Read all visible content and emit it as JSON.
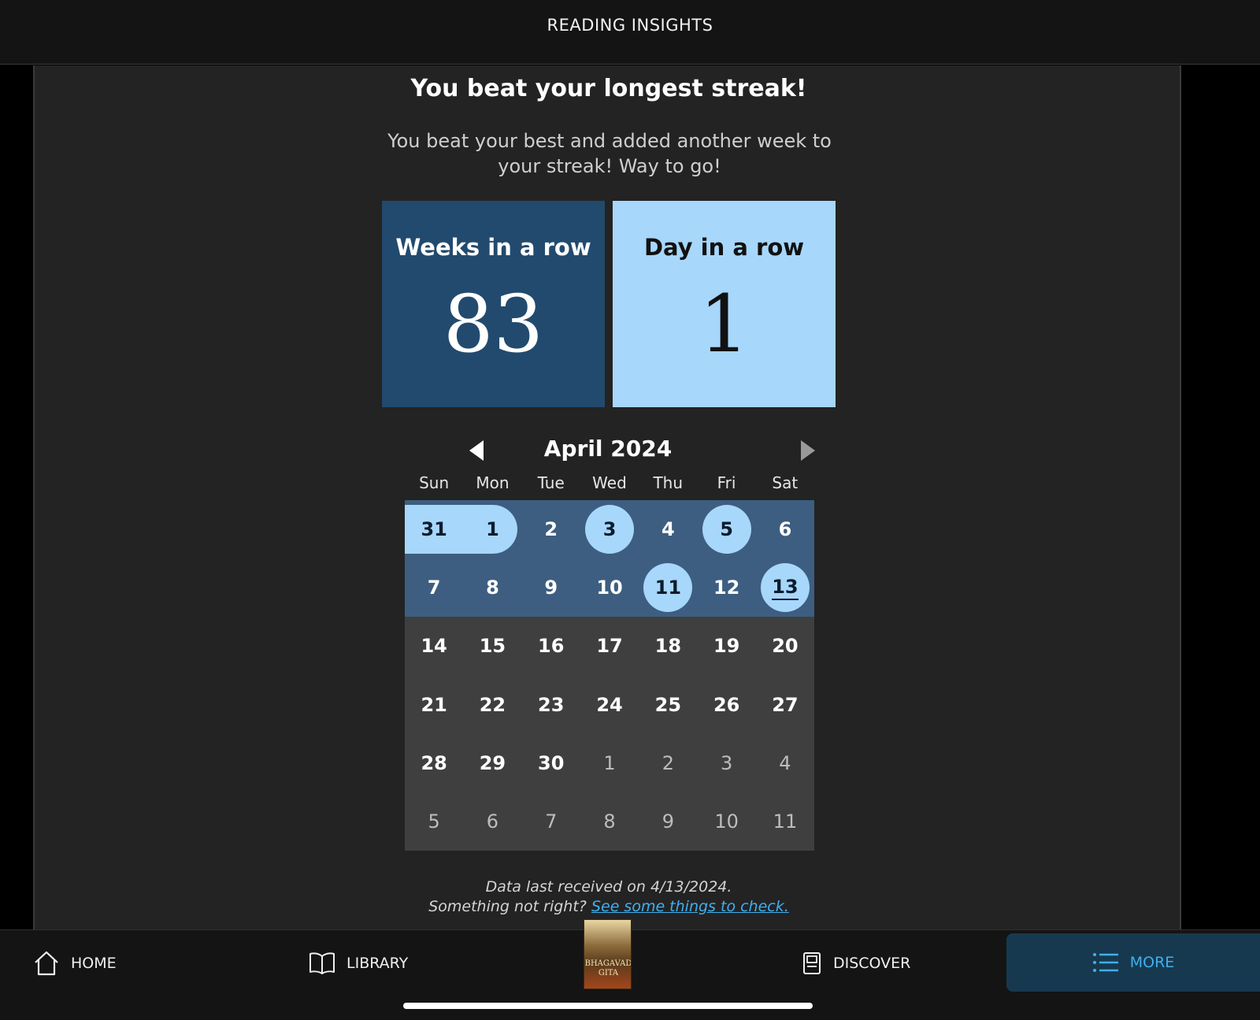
{
  "header": {
    "title": "READING INSIGHTS"
  },
  "main": {
    "headline": "You beat your longest streak!",
    "subtext": "You beat your best and added another week to your streak! Way to go!",
    "cards": {
      "weeks": {
        "label": "Weeks in a row",
        "value": "83"
      },
      "days": {
        "label": "Day in a row",
        "value": "1"
      }
    },
    "accent_colors": {
      "weeks_card": "#224a6e",
      "days_card": "#a7d7fb",
      "link": "#3fb0f0"
    }
  },
  "calendar": {
    "month": "April 2024",
    "prev_icon": "triangle-left-icon",
    "next_icon": "triangle-right-icon",
    "weekdays": [
      "Sun",
      "Mon",
      "Tue",
      "Wed",
      "Thu",
      "Fri",
      "Sat"
    ],
    "weeks": [
      [
        "31",
        "1",
        "2",
        "3",
        "4",
        "5",
        "6"
      ],
      [
        "7",
        "8",
        "9",
        "10",
        "11",
        "12",
        "13"
      ],
      [
        "14",
        "15",
        "16",
        "17",
        "18",
        "19",
        "20"
      ],
      [
        "21",
        "22",
        "23",
        "24",
        "25",
        "26",
        "27"
      ],
      [
        "28",
        "29",
        "30",
        "1",
        "2",
        "3",
        "4"
      ],
      [
        "5",
        "6",
        "7",
        "8",
        "9",
        "10",
        "11"
      ]
    ],
    "read_days": [
      "31",
      "1",
      "3",
      "5",
      "11",
      "13"
    ],
    "today": "13"
  },
  "footer_note": {
    "line1": "Data last received on 4/13/2024.",
    "line2_prefix": "Something not right?",
    "link": "See some things to check."
  },
  "bottom_nav": {
    "home": {
      "label": "HOME",
      "icon": "home-icon"
    },
    "library": {
      "label": "LIBRARY",
      "icon": "open-book-icon"
    },
    "current_book": {
      "cover_text": "BHAGAVAD GITA"
    },
    "discover": {
      "label": "DISCOVER",
      "icon": "store-icon"
    },
    "more": {
      "label": "MORE",
      "icon": "list-icon"
    }
  }
}
